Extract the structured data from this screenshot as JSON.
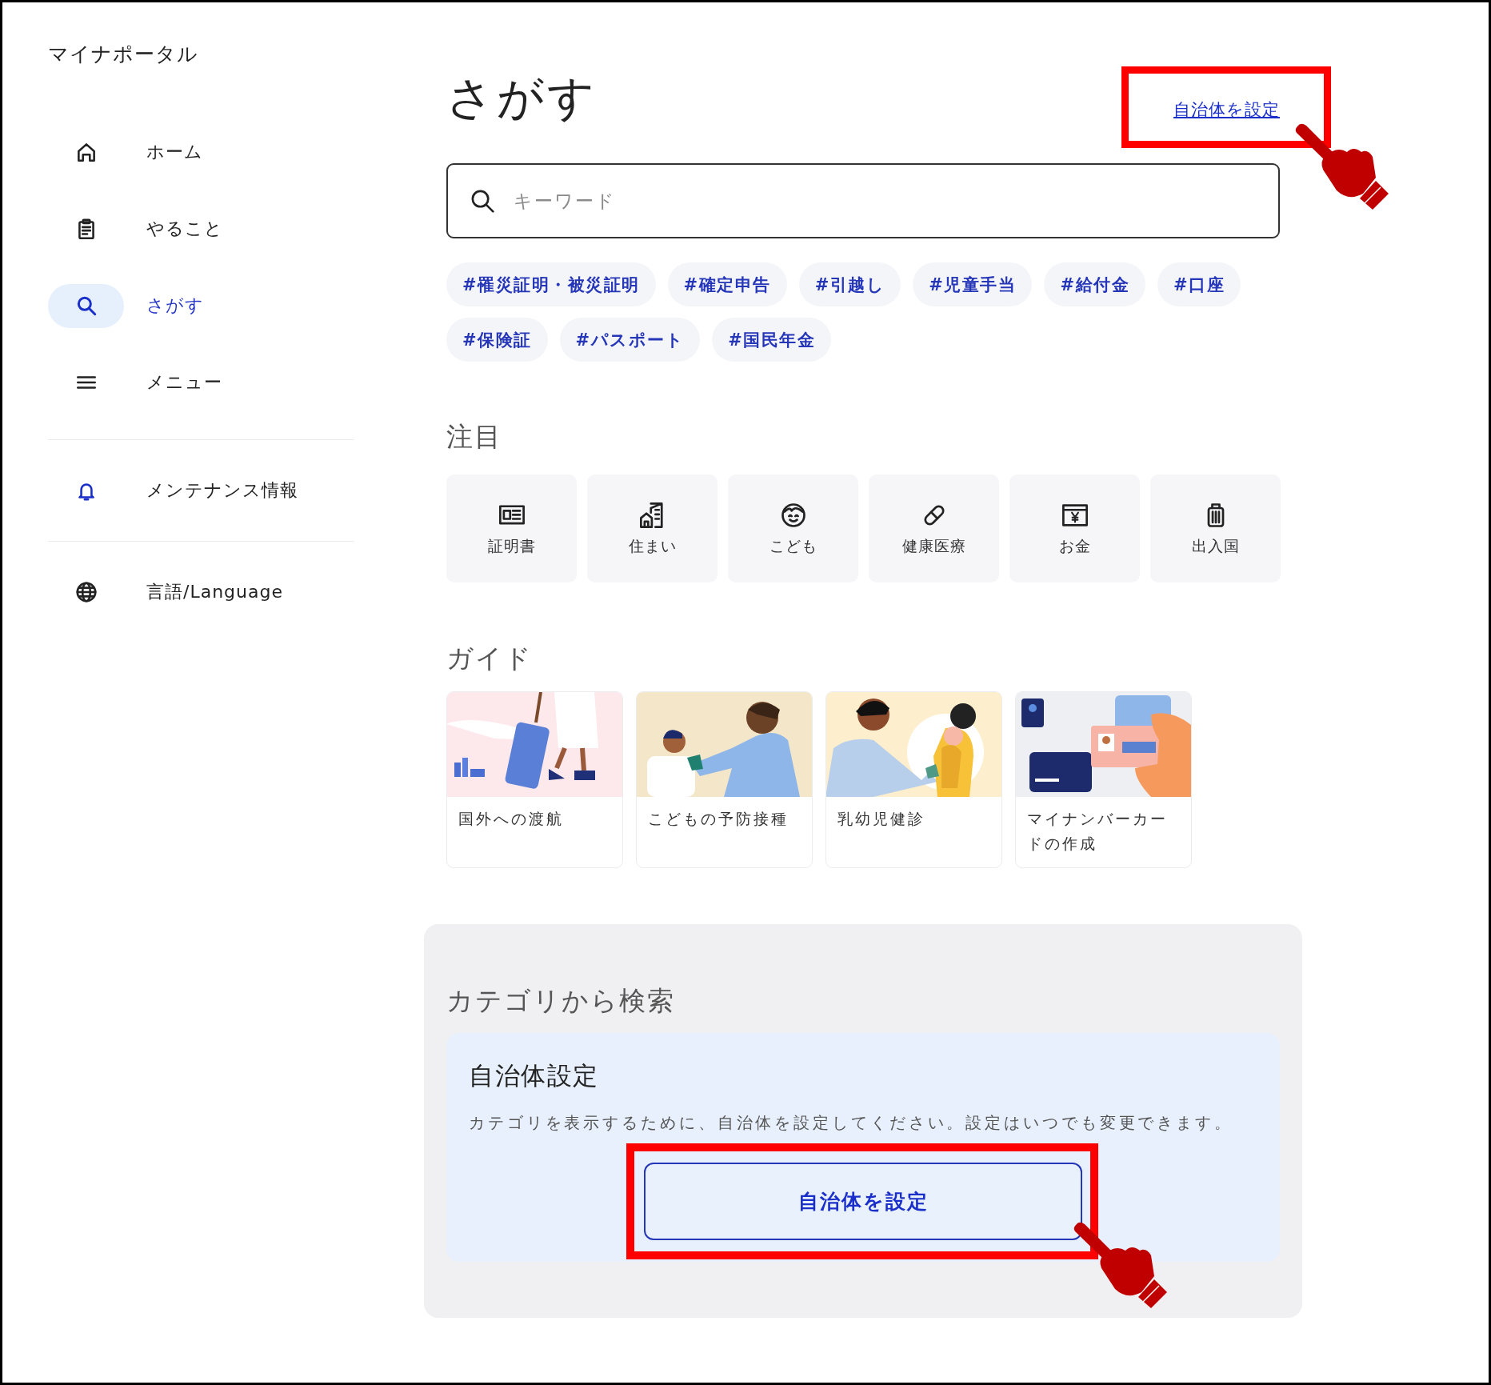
{
  "sidebar": {
    "title": "マイナポータル",
    "nav": [
      {
        "label": "ホーム",
        "selected": false
      },
      {
        "label": "やること",
        "selected": false
      },
      {
        "label": "さがす",
        "selected": true
      },
      {
        "label": "メニュー",
        "selected": false
      }
    ],
    "links": [
      {
        "label": "メンテナンス情報"
      },
      {
        "label": "言語/Language"
      }
    ]
  },
  "main": {
    "heading": "さがす",
    "municipality_link": "自治体を設定",
    "search": {
      "placeholder": "キーワード"
    },
    "tags": [
      "#罹災証明・被災証明",
      "#確定申告",
      "#引越し",
      "#児童手当",
      "#給付金",
      "#口座",
      "#保険証",
      "#パスポート",
      "#国民年金"
    ],
    "featured": {
      "title": "注目",
      "items": [
        "証明書",
        "住まい",
        "こども",
        "健康医療",
        "お金",
        "出入国"
      ]
    },
    "guide": {
      "title": "ガイド",
      "items": [
        "国外への渡航",
        "こどもの予防接種",
        "乳幼児健診",
        "マイナンバーカードの作成"
      ]
    },
    "category_search": {
      "title": "カテゴリから検索",
      "notice": {
        "title": "自治体設定",
        "text": "カテゴリを表示するために、自治体を設定してください。設定はいつでも変更できます。",
        "button": "自治体を設定"
      }
    }
  }
}
